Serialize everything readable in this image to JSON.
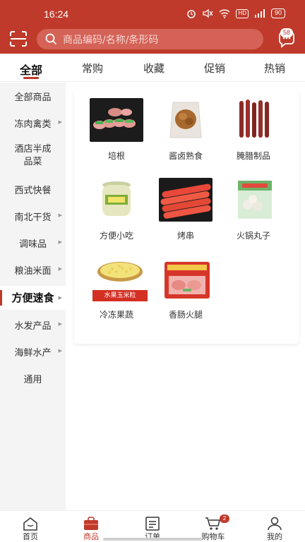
{
  "status_bar": {
    "time": "16:24",
    "battery": "90",
    "hd_label": "HD"
  },
  "header": {
    "search_placeholder": "商品编码/名称/条形码",
    "message_badge": "58"
  },
  "top_tabs": [
    "全部",
    "常购",
    "收藏",
    "促销",
    "热销"
  ],
  "sidebar": {
    "items": [
      {
        "label": "全部商品"
      },
      {
        "label": "冻肉禽类"
      },
      {
        "label": "酒店半成品菜"
      },
      {
        "label": "西式快餐"
      },
      {
        "label": "南北干货"
      },
      {
        "label": "调味品"
      },
      {
        "label": "粮油米面"
      },
      {
        "label": "方便速食"
      },
      {
        "label": "水发产品"
      },
      {
        "label": "海鲜水产"
      },
      {
        "label": "通用"
      }
    ],
    "active": "方便速食"
  },
  "categories": [
    {
      "label": "培根",
      "icon": "bacon-rolls-image"
    },
    {
      "label": "酱卤熟食",
      "icon": "braised-food-image"
    },
    {
      "label": "腌腊制品",
      "icon": "cured-sausage-image"
    },
    {
      "label": "方便小吃",
      "icon": "snack-jar-image"
    },
    {
      "label": "烤串",
      "icon": "grilled-sausage-image"
    },
    {
      "label": "火锅丸子",
      "icon": "hotpot-balls-image"
    },
    {
      "label": "冷冻果蔬",
      "icon": "corn-kernels-image",
      "overlay_text": "水果玉米粒"
    },
    {
      "label": "香肠火腿",
      "icon": "canned-ham-image"
    }
  ],
  "bottom_nav": {
    "items": [
      {
        "label": "首页",
        "icon": "home-icon"
      },
      {
        "label": "商品",
        "icon": "bag-icon"
      },
      {
        "label": "订单",
        "icon": "order-icon"
      },
      {
        "label": "购物车",
        "icon": "cart-icon"
      },
      {
        "label": "我的",
        "icon": "user-icon"
      }
    ],
    "active": "商品",
    "cart_badge": "2"
  },
  "colors": {
    "brand": "#bf3a2b",
    "sidebar_bg": "#f4f4f4"
  }
}
